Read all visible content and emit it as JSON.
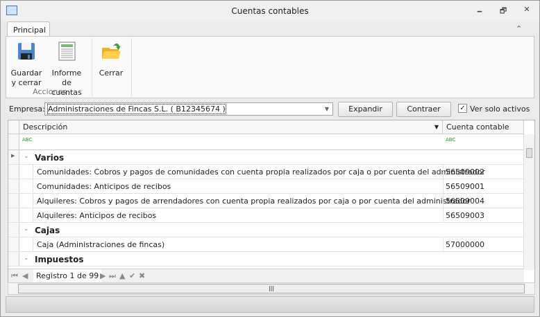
{
  "window": {
    "title": "Cuentas contables",
    "minimize": "🗕",
    "restore": "🗗",
    "close": "✕"
  },
  "ribbon": {
    "tab": "Principal",
    "collapse": "⌃",
    "buttons": [
      {
        "label1": "Guardar",
        "label2": "y cerrar",
        "icon": "save-icon"
      },
      {
        "label1": "Informe de",
        "label2": "cuentas",
        "icon": "report-icon"
      },
      {
        "label1": "Cerrar",
        "label2": "",
        "icon": "folder-close-icon"
      }
    ],
    "group": "Acciones"
  },
  "filter": {
    "empresa_label": "Empresa:",
    "empresa_value": "Administraciones de Fincas S.L. ( B12345674 )",
    "expandir": "Expandir",
    "contraer": "Contraer",
    "solo_activos": "Ver solo activos",
    "solo_activos_checked": true
  },
  "grid": {
    "columns": [
      "Descripción",
      "Cuenta contable"
    ],
    "filter_icon": "ABC",
    "rows": [
      {
        "type": "group",
        "label": "Varios"
      },
      {
        "type": "data",
        "desc": "Comunidades: Cobros y pagos de comunidades con cuenta propia realizados por caja o por cuenta del administrador",
        "cuenta": "56509002"
      },
      {
        "type": "data",
        "desc": "Comunidades: Anticipos de recibos",
        "cuenta": "56509001"
      },
      {
        "type": "data",
        "desc": "Alquileres: Cobros y pagos de arrendadores con cuenta propia realizados por caja o por cuenta del administrador",
        "cuenta": "56509004"
      },
      {
        "type": "data",
        "desc": "Alquileres: Anticipos de recibos",
        "cuenta": "56509003"
      },
      {
        "type": "group",
        "label": "Cajas"
      },
      {
        "type": "data",
        "desc": "Caja (Administraciones de fincas)",
        "cuenta": "57000000"
      },
      {
        "type": "group",
        "label": "Impuestos"
      }
    ],
    "navigator": {
      "record": "Registro 1 de 99"
    }
  }
}
